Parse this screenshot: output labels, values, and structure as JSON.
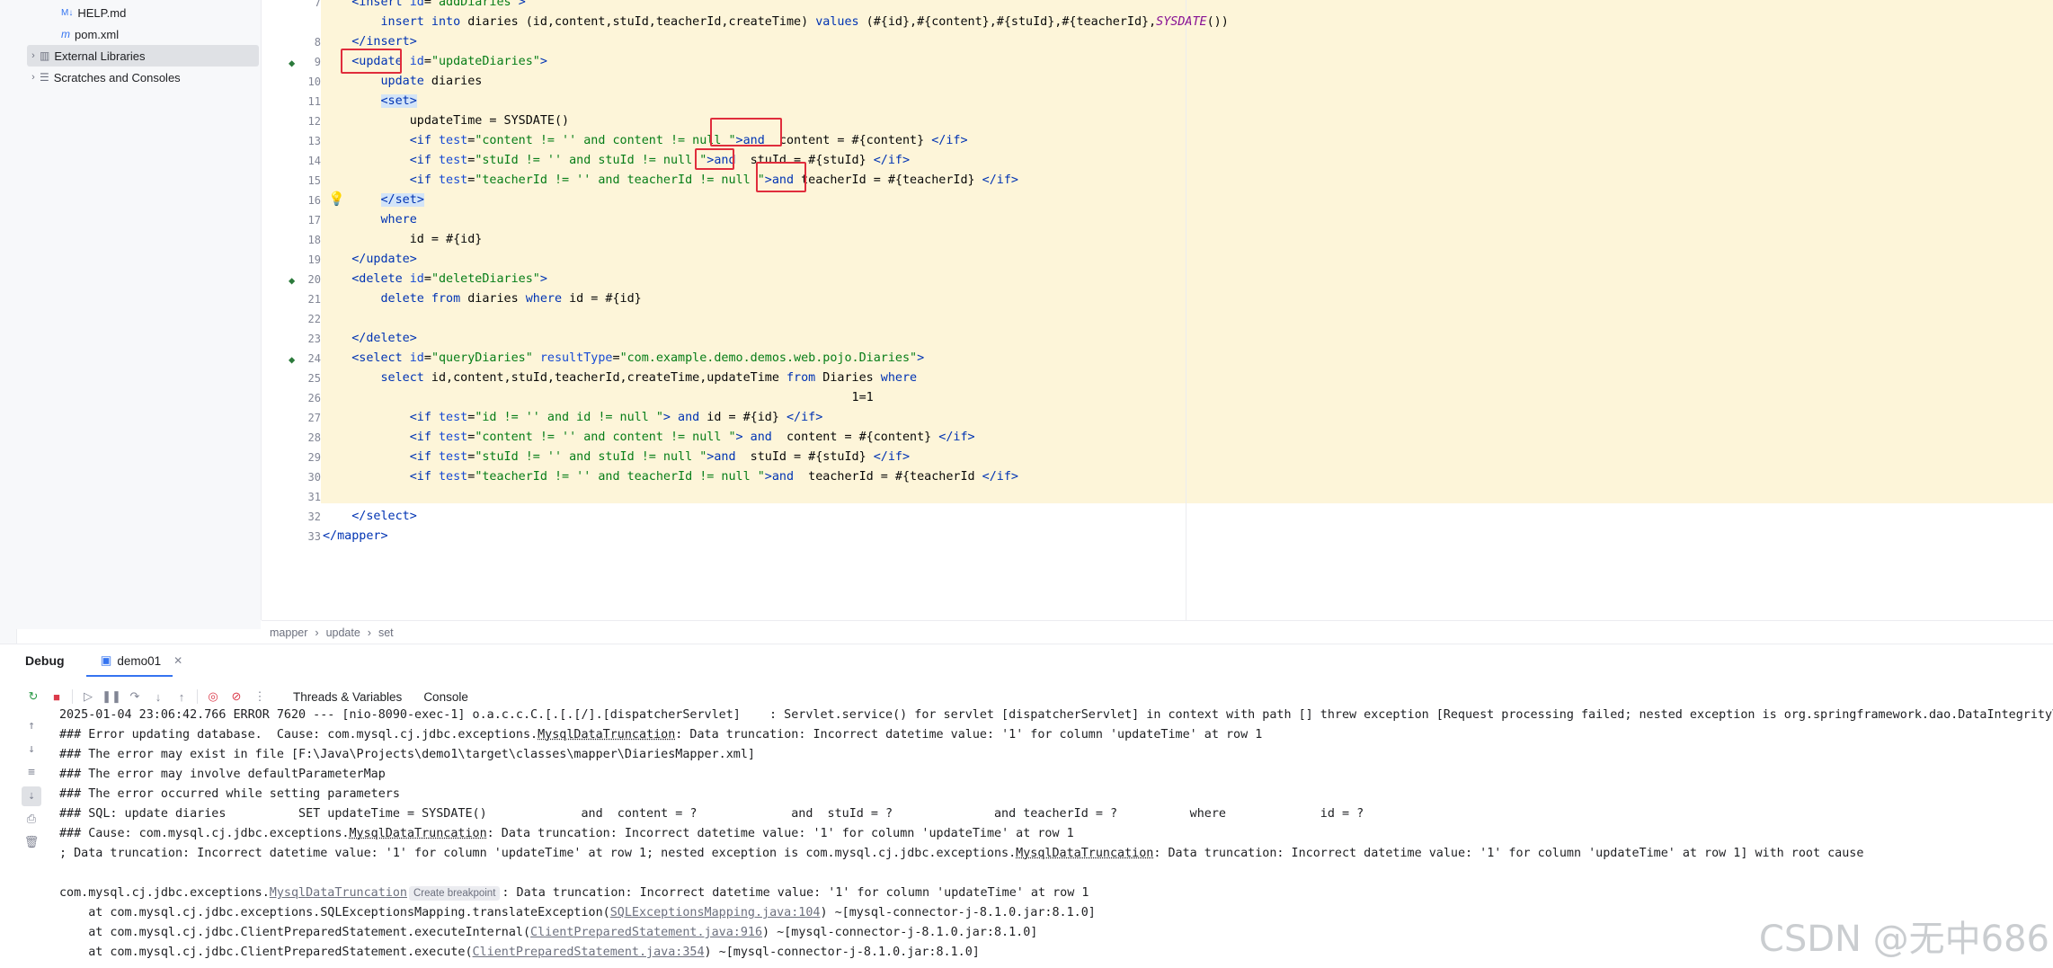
{
  "project_tree": {
    "items": [
      {
        "label": "HELP.md",
        "icon": "markdown-file-icon"
      },
      {
        "label": "pom.xml",
        "icon": "maven-file-icon"
      },
      {
        "label": "External Libraries",
        "icon": "library-icon"
      },
      {
        "label": "Scratches and Consoles",
        "icon": "scratches-icon"
      }
    ]
  },
  "editor": {
    "breadcrumbs": [
      "mapper",
      "update",
      "set"
    ],
    "lines": [
      {
        "n": "7",
        "t": "    <insert id=\"addDiaries\">"
      },
      {
        "n": "",
        "t": "        insert into diaries (id,content,stuId,teacherId,createTime) values (#{id},#{content},#{stuId},#{teacherId},SYSDATE())"
      },
      {
        "n": "8",
        "t": "    </insert>"
      },
      {
        "n": "9",
        "t": "    <update id=\"updateDiaries\">"
      },
      {
        "n": "10",
        "t": "        update diaries"
      },
      {
        "n": "11",
        "t": "        <set>"
      },
      {
        "n": "12",
        "t": "            updateTime = SYSDATE()"
      },
      {
        "n": "13",
        "t": "            <if test=\"content != '' and content != null \">and  content = #{content} </if>"
      },
      {
        "n": "14",
        "t": "            <if test=\"stuId != '' and stuId != null \">and  stuId = #{stuId} </if>"
      },
      {
        "n": "15",
        "t": "            <if test=\"teacherId != '' and teacherId != null \">and teacherId = #{teacherId} </if>"
      },
      {
        "n": "16",
        "t": "        </set>"
      },
      {
        "n": "17",
        "t": "        where"
      },
      {
        "n": "18",
        "t": "            id = #{id}"
      },
      {
        "n": "19",
        "t": "    </update>"
      },
      {
        "n": "20",
        "t": "    <delete id=\"deleteDiaries\">"
      },
      {
        "n": "21",
        "t": "        delete from diaries where id = #{id}"
      },
      {
        "n": "22",
        "t": ""
      },
      {
        "n": "23",
        "t": "    </delete>"
      },
      {
        "n": "24",
        "t": "    <select id=\"queryDiaries\" resultType=\"com.example.demo.demos.web.pojo.Diaries\">"
      },
      {
        "n": "25",
        "t": "        select id,content,stuId,teacherId,createTime,updateTime from Diaries where"
      },
      {
        "n": "26",
        "t": "                                                                         1=1"
      },
      {
        "n": "27",
        "t": "            <if test=\"id != '' and id != null \"> and id = #{id} </if>"
      },
      {
        "n": "28",
        "t": "            <if test=\"content != '' and content != null \"> and  content = #{content} </if>"
      },
      {
        "n": "29",
        "t": "            <if test=\"stuId != '' and stuId != null \">and  stuId = #{stuId} </if>"
      },
      {
        "n": "30",
        "t": "            <if test=\"teacherId != '' and teacherId != null \">and  teacherId = #{teacherId </if>"
      },
      {
        "n": "31",
        "t": ""
      },
      {
        "n": "32",
        "t": "    </select>"
      },
      {
        "n": "33",
        "t": "</mapper>"
      }
    ]
  },
  "debug": {
    "title": "Debug",
    "session_tab": "demo01",
    "tabs": [
      "Threads & Variables",
      "Console"
    ],
    "console_lines": [
      "2025-01-04 23:06:42.766 ERROR 7620 --- [nio-8090-exec-1] o.a.c.c.C.[.[.[/].[dispatcherServlet]    : Servlet.service() for servlet [dispatcherServlet] in context with path [] threw exception [Request processing failed; nested exception is org.springframework.dao.DataIntegrityVi",
      "### Error updating database.  Cause: com.mysql.cj.jdbc.exceptions.MysqlDataTruncation: Data truncation: Incorrect datetime value: '1' for column 'updateTime' at row 1",
      "### The error may exist in file [F:\\Java\\Projects\\demo1\\target\\classes\\mapper\\DiariesMapper.xml]",
      "### The error may involve defaultParameterMap",
      "### The error occurred while setting parameters",
      "### SQL: update diaries          SET updateTime = SYSDATE()             and  content = ?             and  stuId = ?              and teacherId = ?          where             id = ?",
      "### Cause: com.mysql.cj.jdbc.exceptions.MysqlDataTruncation: Data truncation: Incorrect datetime value: '1' for column 'updateTime' at row 1",
      "; Data truncation: Incorrect datetime value: '1' for column 'updateTime' at row 1; nested exception is com.mysql.cj.jdbc.exceptions.MysqlDataTruncation: Data truncation: Incorrect datetime value: '1' for column 'updateTime' at row 1] with root cause",
      ""
    ],
    "exception": {
      "prefix": "com.mysql.cj.jdbc.exceptions.",
      "cls": "MysqlDataTruncation",
      "chip": "Create breakpoint",
      "msg": ": Data truncation: Incorrect datetime value: '1' for column 'updateTime' at row 1"
    },
    "stack": [
      {
        "pre": "    at com.mysql.cj.jdbc.exceptions.SQLExceptionsMapping.translateException(",
        "link": "SQLExceptionsMapping.java:104",
        "post": ") ~[mysql-connector-j-8.1.0.jar:8.1.0]"
      },
      {
        "pre": "    at com.mysql.cj.jdbc.ClientPreparedStatement.executeInternal(",
        "link": "ClientPreparedStatement.java:916",
        "post": ") ~[mysql-connector-j-8.1.0.jar:8.1.0]"
      },
      {
        "pre": "    at com.mysql.cj.jdbc.ClientPreparedStatement.execute(",
        "link": "ClientPreparedStatement.java:354",
        "post": ") ~[mysql-connector-j-8.1.0.jar:8.1.0]"
      }
    ]
  },
  "watermark": "CSDN @无中686"
}
